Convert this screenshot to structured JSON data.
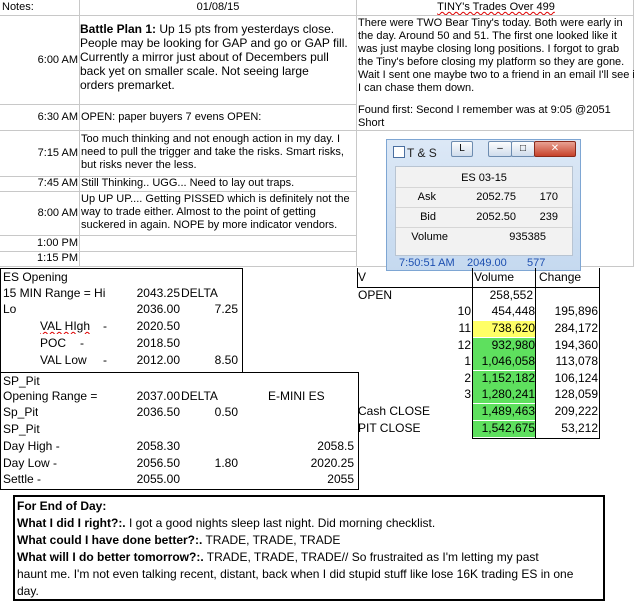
{
  "header": {
    "notes_label": "Notes:",
    "date": "01/08/15",
    "tiny_title": "TINY's Trades Over 499"
  },
  "log": {
    "t600": "6:00 AM",
    "plan_bold": "Battle Plan 1:",
    "plan_l1": " Up 15 pts from yesterdays close.",
    "plan_l2": "People may be looking for GAP and go or GAP fill.",
    "plan_l3": "Currently a mirror just about of Decembers pull",
    "plan_l4": "back yet on smaller scale.  Not seeing large",
    "plan_l5": "orders premarket.",
    "t630": "6:30 AM",
    "n630": "OPEN: paper buyers 7 evens OPEN:",
    "t715": "7:15 AM",
    "n715_l1": "Too much thinking and not enough action in my day.  I",
    "n715_l2": "need to pull the trigger and take the risks.  Smart risks,",
    "n715_l3": "but risks never the less.",
    "t745": "7:45 AM",
    "n745": "Still Thinking.. UGG... Need to lay out traps.",
    "t800": "8:00 AM",
    "n800_l1": "Up UP UP.... Getting PISSED which is definitely not the",
    "n800_l2": "way to trade either.  Almost to the point of getting",
    "n800_l3": "suckered in again.  NOPE by more indicator vendors.",
    "t100": "1:00 PM",
    "t115": "1:15 PM"
  },
  "tiny": {
    "p1_l1": "There were TWO Bear Tiny's today.  Both were early in",
    "p1_l2": "the day.  Around 50 and 51.  The first one looked like it",
    "p1_l3": "was just maybe closing long positions.  I forgot to grab",
    "p1_l4": "the Tiny's before closing my platform so they are gone.",
    "p1_l5": "Wait I sent one maybe two to a friend in an email I'll see if",
    "p1_l6": "I can chase them down.",
    "p2_l1": "Found first: Second I remember was at 9:05 @2051",
    "p2_l2": "Short"
  },
  "ts_window": {
    "title": "T & S",
    "btn_l": "L",
    "btn_min": "–",
    "btn_max": "□",
    "btn_close": "✕",
    "symbol": "ES 03-15",
    "ask_label": "Ask",
    "ask_price": "2052.75",
    "ask_size": "170",
    "bid_label": "Bid",
    "bid_price": "2052.50",
    "bid_size": "239",
    "vol_label": "Volume",
    "vol_value": "935385",
    "foot_time": "7:50:51 AM",
    "foot_price": "2049.00",
    "foot_size": "577"
  },
  "es_opening": {
    "title": "ES Opening",
    "range_label": "15 MIN Range = Hi",
    "hi": "2043.25",
    "delta_label": "DELTA",
    "lo_label": "Lo",
    "lo": "2036.00",
    "delta1": "7.25",
    "vah_label": "VAL HIgh",
    "vah": "2020.50",
    "poc_label": "POC",
    "poc": "2018.50",
    "val_label": "VAL Low",
    "val": "2012.00",
    "delta2": "8.50",
    "dash": "-"
  },
  "sp_pit": {
    "l1": "SP_Pit",
    "l2": "Opening Range =",
    "or_val": "2037.00",
    "delta_label": "DELTA",
    "emini": "E-MINI ES",
    "l3": "Sp_Pit",
    "sp_val": "2036.50",
    "sp_delta": "0.50",
    "l4": "SP_Pit",
    "dh_label": "Day High -",
    "dh": "2058.30",
    "dh_e": "2058.5",
    "dl_label": "Day Low -",
    "dl": "2056.50",
    "dl_delta": "1.80",
    "dl_e": "2020.25",
    "st_label": "Settle -",
    "st": "2055.00",
    "st_e": "2055"
  },
  "volume_table": {
    "v_head": "V",
    "vol_head": "Volume",
    "chg_head": "Change",
    "open_label": "OPEN",
    "open_vol": "258,552",
    "rows": [
      {
        "label": "10",
        "vol": "454,448",
        "chg": "195,896"
      },
      {
        "label": "11",
        "vol": "738,620",
        "chg": "284,172"
      },
      {
        "label": "12",
        "vol": "932,980",
        "chg": "194,360"
      },
      {
        "label": "1",
        "vol": "1,046,058",
        "chg": "113,078"
      },
      {
        "label": "2",
        "vol": "1,152,182",
        "chg": "106,124"
      },
      {
        "label": "3",
        "vol": "1,280,241",
        "chg": "128,059"
      }
    ],
    "cash_label": "Cash CLOSE",
    "cash_vol": "1,489,463",
    "cash_chg": "209,222",
    "pit_label": "PIT CLOSE",
    "pit_vol": "1,542,675",
    "pit_chg": "53,212",
    "colors": {
      "highlight_green": "#5ee05e",
      "highlight_yellow": "#ffff66"
    }
  },
  "eod": {
    "title": "For End of Day:",
    "q1": "What I did I right?:.",
    "a1": "  I got a good nights sleep last night.  Did morning checklist.",
    "q2": "What could I have done better?:.",
    "a2": "  TRADE, TRADE, TRADE",
    "q3": "What will I do better tomorrow?:.",
    "a3": "  TRADE, TRADE, TRADE//  So frustraited as I'm letting my past",
    "a3b": "haunt me.  I'm not even talking recent, distant, back when I did stupid stuff like lose 16K trading ES in one",
    "a3c": "day."
  }
}
